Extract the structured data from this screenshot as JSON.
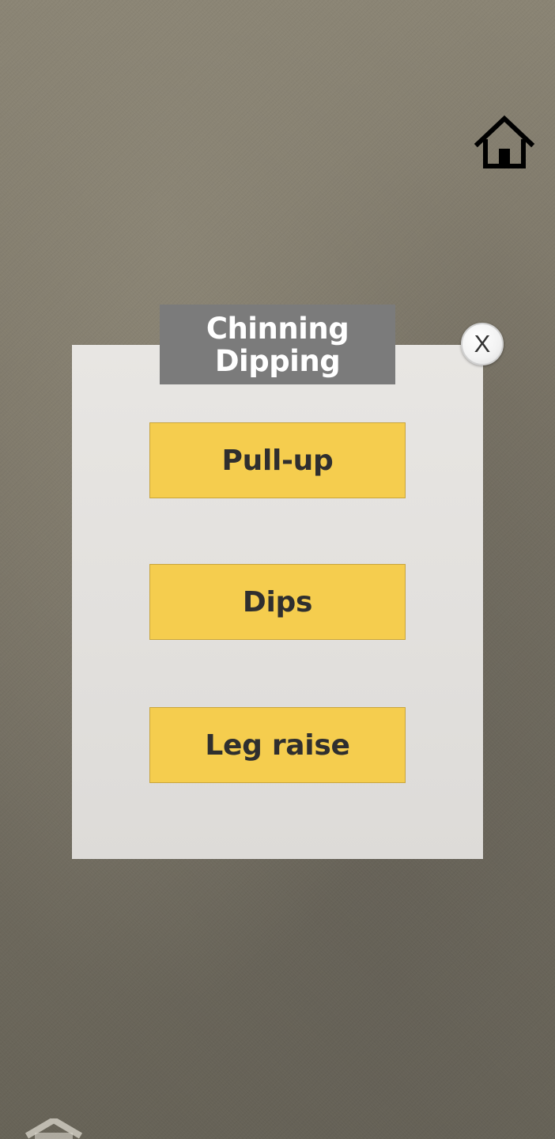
{
  "header": {
    "home_icon": "home-icon"
  },
  "dialog": {
    "title_line1": "Chinning",
    "title_line2": "Dipping",
    "close_label": "X",
    "buttons": [
      {
        "label": "Pull-up"
      },
      {
        "label": "Dips"
      },
      {
        "label": "Leg raise"
      }
    ]
  },
  "colors": {
    "button_fill": "#f5cd4e",
    "title_bar": "#7b7b7b",
    "panel": "#e3e1de"
  }
}
